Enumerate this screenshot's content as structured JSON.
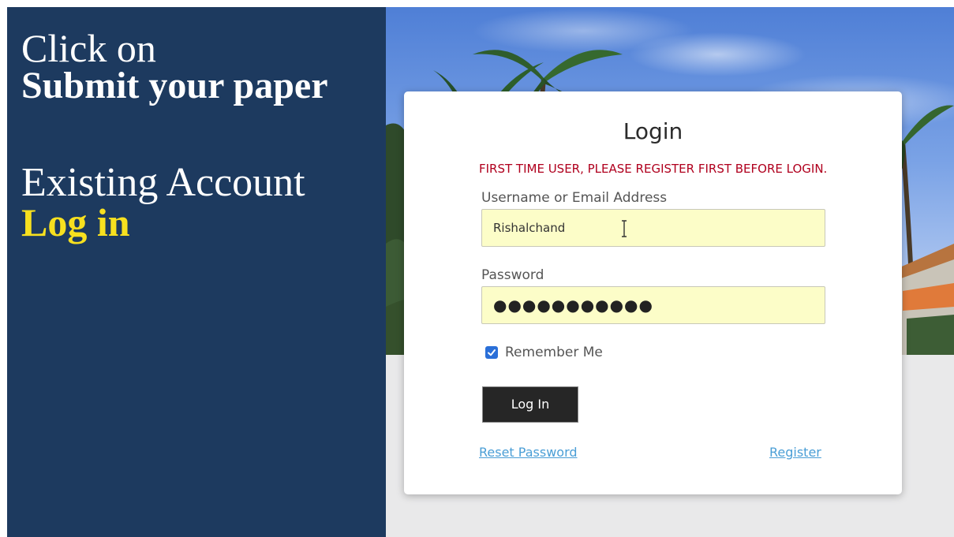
{
  "left_panel": {
    "line1": "Click on",
    "line2": "Submit your paper",
    "line3": "Existing Account",
    "line4": "Log in",
    "background_color": "#1d3a5f",
    "highlight_color": "#f7e01f"
  },
  "login": {
    "title": "Login",
    "notice": "FIRST TIME USER, PLEASE REGISTER FIRST BEFORE LOGIN.",
    "username_label": "Username or Email Address",
    "username_value": "Rishalchand",
    "password_label": "Password",
    "password_mask": "●●●●●●●●●●●",
    "remember_label": "Remember Me",
    "remember_checked": true,
    "submit_label": "Log In",
    "reset_link": "Reset Password",
    "register_link": "Register",
    "notice_color": "#b0001e",
    "link_color": "#4a9ed6",
    "field_bg_color": "#fcfdc8"
  }
}
